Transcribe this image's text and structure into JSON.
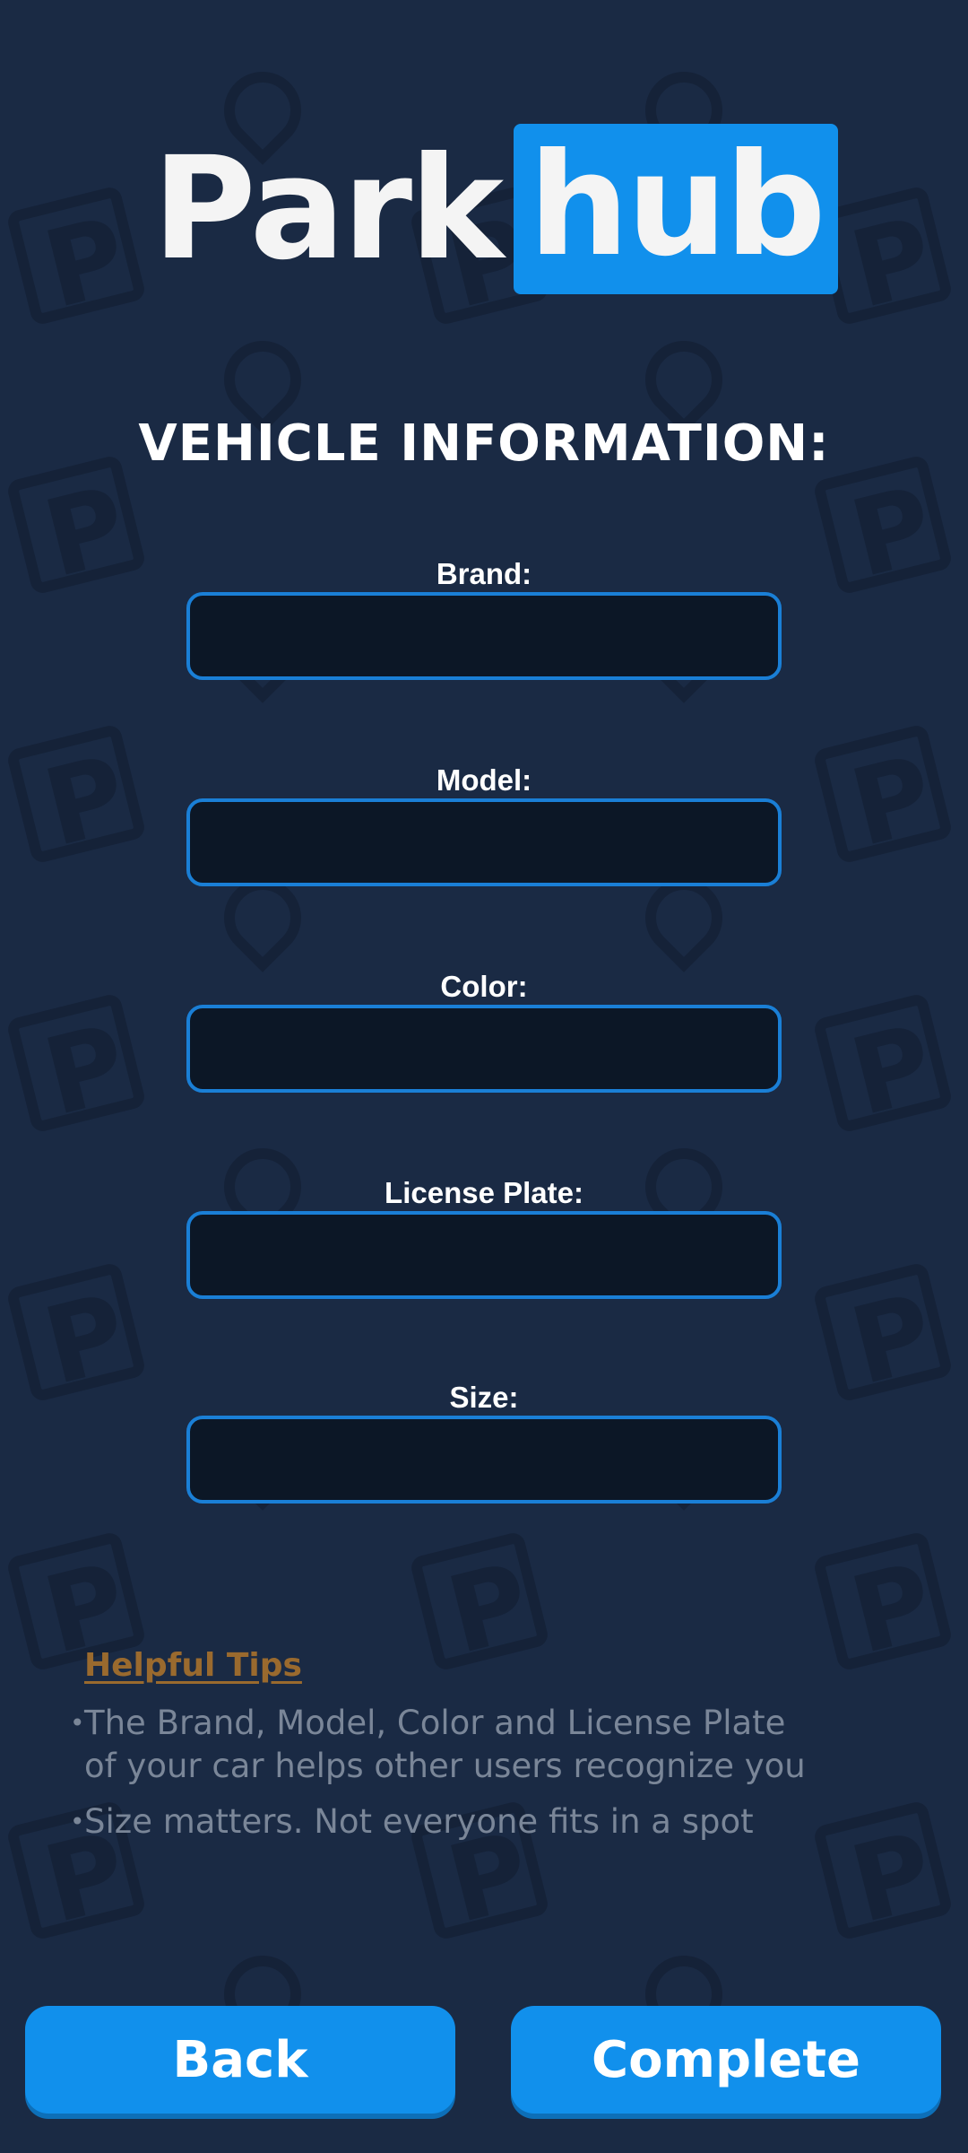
{
  "logo": {
    "part1": "Park",
    "part2": "hub"
  },
  "section_title": "VEHICLE INFORMATION:",
  "form": {
    "fields": [
      {
        "label": "Brand:",
        "value": ""
      },
      {
        "label": "Model:",
        "value": ""
      },
      {
        "label": "Color:",
        "value": ""
      },
      {
        "label": "License Plate:",
        "value": ""
      },
      {
        "label": "Size:",
        "value": ""
      }
    ]
  },
  "tips": {
    "heading": "Helpful Tips",
    "bullet": "•",
    "items": [
      "The Brand, Model, Color and License Plate\n of your car helps other users recognize you",
      "Size matters. Not everyone fits in a spot"
    ]
  },
  "buttons": {
    "back": "Back",
    "complete": "Complete"
  },
  "colors": {
    "background": "#1a2a44",
    "accent": "#1190ec",
    "input_border": "#1a7fd6",
    "tips_heading": "#9a6a2e"
  },
  "icons": {
    "background": [
      "parking-sign-icon",
      "map-pin-icon"
    ]
  }
}
